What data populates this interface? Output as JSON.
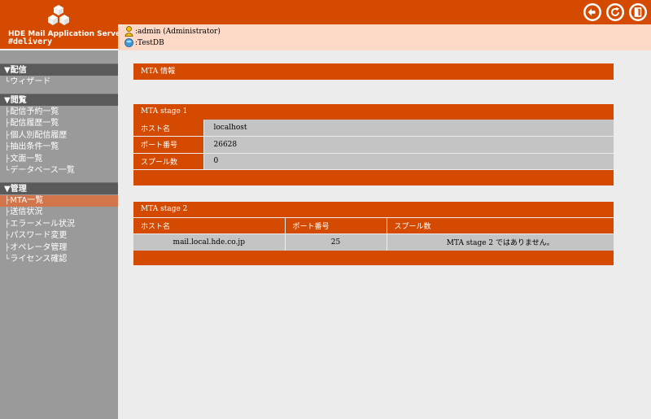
{
  "app": {
    "title": "HDE Mail Application Server",
    "subtitle": "#delivery"
  },
  "header": {
    "user": ":admin (Administrator)",
    "db": ":TestDB",
    "icons": [
      "back-arrow-icon",
      "refresh-icon",
      "logout-door-icon"
    ]
  },
  "sidebar": {
    "sections": [
      {
        "label": "▼配信",
        "items": [
          "ウィザード"
        ]
      },
      {
        "label": "▼閲覧",
        "items": [
          "配信予約一覧",
          "配信履歴一覧",
          "個人別配信履歴",
          "抽出条件一覧",
          "文面一覧",
          "データベース一覧"
        ]
      },
      {
        "label": "▼管理",
        "items": [
          "MTA一覧",
          "送信状況",
          "エラーメール状況",
          "パスワード変更",
          "オペレータ管理",
          "ライセンス確認"
        ]
      }
    ],
    "active_item": "MTA一覧"
  },
  "main": {
    "info_title": "MTA 情報",
    "stage1": {
      "title": "MTA stage 1",
      "rows": [
        {
          "key": "ホスト名",
          "value": "localhost"
        },
        {
          "key": "ポート番号",
          "value": "26628"
        },
        {
          "key": "スプール数",
          "value": "0"
        }
      ]
    },
    "stage2": {
      "title": "MTA stage 2",
      "columns": [
        "ホスト名",
        "ポート番号",
        "スプール数"
      ],
      "rows": [
        [
          "mail.local.hde.co.jp",
          "25",
          "MTA stage 2 ではありません。"
        ]
      ]
    }
  },
  "colors": {
    "accent": "#d44a00",
    "band": "#fcd9c6",
    "sidebar": "#9a9a9a",
    "sidebar_head": "#5a5a5a",
    "active": "#d2754a",
    "cell": "#c4c4c4",
    "background": "#ececec"
  }
}
